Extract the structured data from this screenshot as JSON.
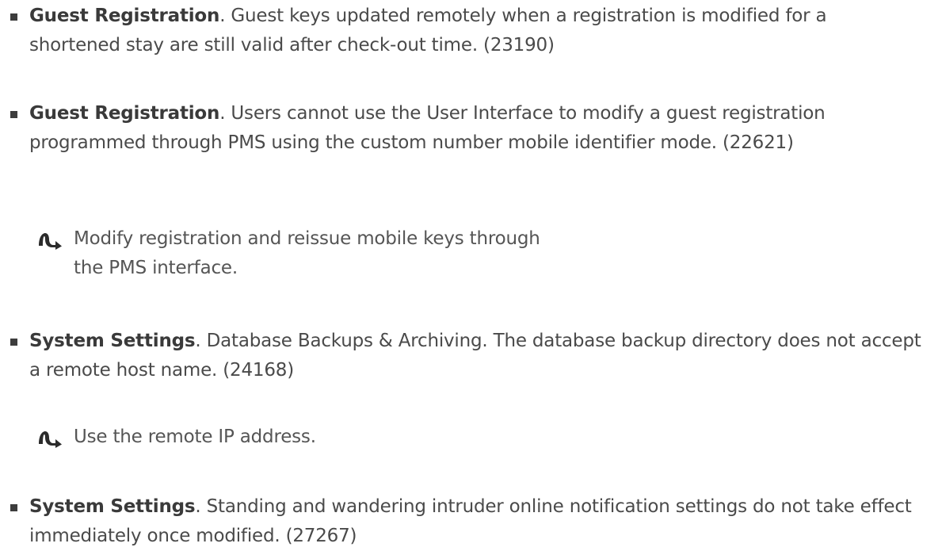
{
  "items": [
    {
      "title": "Guest Registration",
      "text": ". Guest keys updated remotely when a registration is modified for a shortened stay are still valid after check-out time. (23190)"
    },
    {
      "title": "Guest Registration",
      "text": ". Users cannot use the User Interface to modify a guest registration programmed through PMS using the custom number mobile identifier mode. (22621)"
    },
    {
      "title": "System Settings",
      "text": ". Database Backups & Archiving. The database backup directory does not accept a remote host name. (24168)"
    },
    {
      "title": "System Settings",
      "text": ". Standing and wandering intruder online notification settings do not take effect immediately once modified. (27267)"
    }
  ],
  "workarounds": [
    {
      "icon": "workaround-arrow-icon",
      "text": "Modify registration and reissue mobile keys through the PMS interface."
    },
    {
      "icon": "workaround-arrow-icon",
      "text": "Use the remote IP address."
    }
  ],
  "colors": {
    "text": "#4a4a4a",
    "bold_text": "#3a3a3a",
    "bullet": "#3d3d3d",
    "icon": "#2b2b2b"
  }
}
